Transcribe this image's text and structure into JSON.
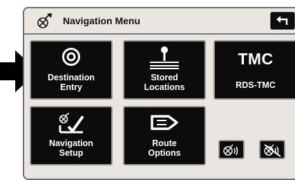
{
  "header": {
    "title": "Navigation Menu"
  },
  "tiles": {
    "destination_entry": {
      "label": "Destination\nEntry"
    },
    "stored_locations": {
      "label": "Stored\nLocations"
    },
    "tmc": {
      "title": "TMC",
      "subtitle": "RDS-TMC"
    },
    "navigation_setup": {
      "label": "Navigation\nSetup"
    },
    "route_options": {
      "label": "Route\nOptions"
    }
  },
  "icons": {
    "header": "nav-satellite-icon",
    "back": "return-arrow-icon",
    "destination": "target-icon",
    "stored": "pin-on-lines-icon",
    "setup": "satellite-checkmark-icon",
    "route": "route-arrow-icon",
    "voice_on": "voice-guidance-on-icon",
    "voice_off": "voice-guidance-muted-icon",
    "pointer": "pointing-arrow-icon"
  },
  "colors": {
    "tile_bg": "#0c0c0c",
    "screen_bg": "#e9e6e2",
    "tile_border": "#9a9a9a",
    "text_light": "#ffffff"
  }
}
